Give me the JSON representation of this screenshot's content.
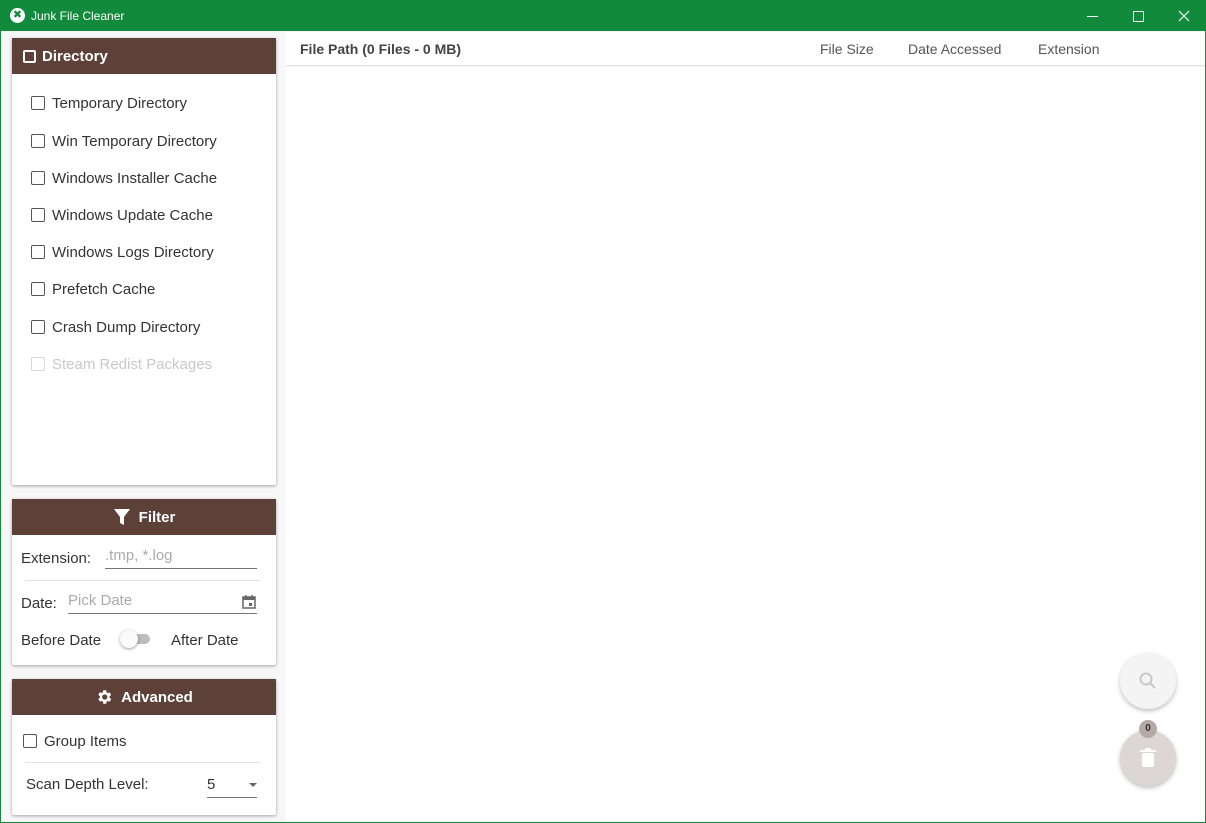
{
  "window": {
    "title": "Junk File Cleaner",
    "accent": "#118a3b",
    "panel_header_color": "#5d4037"
  },
  "directory_panel": {
    "title": "Directory",
    "items": [
      {
        "label": "Temporary Directory",
        "checked": false,
        "enabled": true
      },
      {
        "label": "Win Temporary Directory",
        "checked": false,
        "enabled": true
      },
      {
        "label": "Windows Installer Cache",
        "checked": false,
        "enabled": true
      },
      {
        "label": "Windows Update Cache",
        "checked": false,
        "enabled": true
      },
      {
        "label": "Windows Logs Directory",
        "checked": false,
        "enabled": true
      },
      {
        "label": "Prefetch Cache",
        "checked": false,
        "enabled": true
      },
      {
        "label": "Crash Dump Directory",
        "checked": false,
        "enabled": true
      },
      {
        "label": "Steam Redist Packages",
        "checked": false,
        "enabled": false
      }
    ]
  },
  "filter_panel": {
    "title": "Filter",
    "extension_label": "Extension:",
    "extension_placeholder": ".tmp, *.log",
    "date_label": "Date:",
    "date_placeholder": "Pick Date",
    "before_label": "Before Date",
    "after_label": "After Date",
    "toggle_on": false
  },
  "advanced_panel": {
    "title": "Advanced",
    "group_items_label": "Group Items",
    "group_items_checked": false,
    "scan_depth_label": "Scan Depth Level:",
    "scan_depth_value": "5"
  },
  "file_list": {
    "columns": {
      "path": "File Path (0 Files - 0 MB)",
      "size": "File Size",
      "accessed": "Date Accessed",
      "extension": "Extension"
    },
    "rows": []
  },
  "actions": {
    "search_icon": "search-icon",
    "delete_icon": "trash-icon",
    "delete_count": "0"
  }
}
